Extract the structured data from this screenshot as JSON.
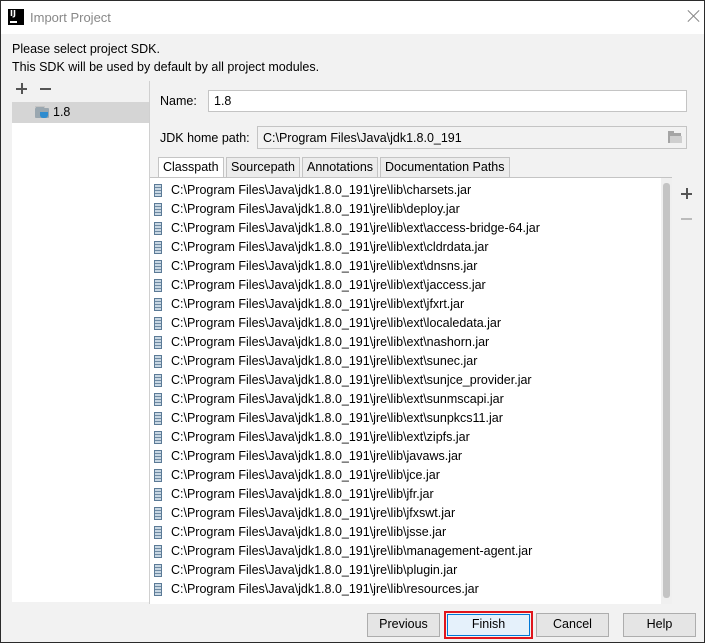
{
  "window": {
    "title": "Import Project",
    "app_icon": "intellij-icon"
  },
  "message": {
    "line1": "Please select project SDK.",
    "line2": "This SDK will be used by default by all project modules."
  },
  "sdk_list": {
    "items": [
      {
        "label": "1.8",
        "icon": "jdk-folder-icon"
      }
    ]
  },
  "form": {
    "name_label": "Name:",
    "name_value": "1.8",
    "home_label": "JDK home path:",
    "home_value": "C:\\Program Files\\Java\\jdk1.8.0_191"
  },
  "tabs": [
    {
      "label": "Classpath",
      "active": true
    },
    {
      "label": "Sourcepath",
      "active": false
    },
    {
      "label": "Annotations",
      "active": false
    },
    {
      "label": "Documentation Paths",
      "active": false
    }
  ],
  "classpath": [
    "C:\\Program Files\\Java\\jdk1.8.0_191\\jre\\lib\\charsets.jar",
    "C:\\Program Files\\Java\\jdk1.8.0_191\\jre\\lib\\deploy.jar",
    "C:\\Program Files\\Java\\jdk1.8.0_191\\jre\\lib\\ext\\access-bridge-64.jar",
    "C:\\Program Files\\Java\\jdk1.8.0_191\\jre\\lib\\ext\\cldrdata.jar",
    "C:\\Program Files\\Java\\jdk1.8.0_191\\jre\\lib\\ext\\dnsns.jar",
    "C:\\Program Files\\Java\\jdk1.8.0_191\\jre\\lib\\ext\\jaccess.jar",
    "C:\\Program Files\\Java\\jdk1.8.0_191\\jre\\lib\\ext\\jfxrt.jar",
    "C:\\Program Files\\Java\\jdk1.8.0_191\\jre\\lib\\ext\\localedata.jar",
    "C:\\Program Files\\Java\\jdk1.8.0_191\\jre\\lib\\ext\\nashorn.jar",
    "C:\\Program Files\\Java\\jdk1.8.0_191\\jre\\lib\\ext\\sunec.jar",
    "C:\\Program Files\\Java\\jdk1.8.0_191\\jre\\lib\\ext\\sunjce_provider.jar",
    "C:\\Program Files\\Java\\jdk1.8.0_191\\jre\\lib\\ext\\sunmscapi.jar",
    "C:\\Program Files\\Java\\jdk1.8.0_191\\jre\\lib\\ext\\sunpkcs11.jar",
    "C:\\Program Files\\Java\\jdk1.8.0_191\\jre\\lib\\ext\\zipfs.jar",
    "C:\\Program Files\\Java\\jdk1.8.0_191\\jre\\lib\\javaws.jar",
    "C:\\Program Files\\Java\\jdk1.8.0_191\\jre\\lib\\jce.jar",
    "C:\\Program Files\\Java\\jdk1.8.0_191\\jre\\lib\\jfr.jar",
    "C:\\Program Files\\Java\\jdk1.8.0_191\\jre\\lib\\jfxswt.jar",
    "C:\\Program Files\\Java\\jdk1.8.0_191\\jre\\lib\\jsse.jar",
    "C:\\Program Files\\Java\\jdk1.8.0_191\\jre\\lib\\management-agent.jar",
    "C:\\Program Files\\Java\\jdk1.8.0_191\\jre\\lib\\plugin.jar",
    "C:\\Program Files\\Java\\jdk1.8.0_191\\jre\\lib\\resources.jar"
  ],
  "buttons": {
    "previous": "Previous",
    "finish": "Finish",
    "cancel": "Cancel",
    "help": "Help"
  },
  "colors": {
    "highlight_outline": "#e0151b",
    "default_button_border": "#0078d7",
    "selection_bg": "#d5d5d5"
  }
}
